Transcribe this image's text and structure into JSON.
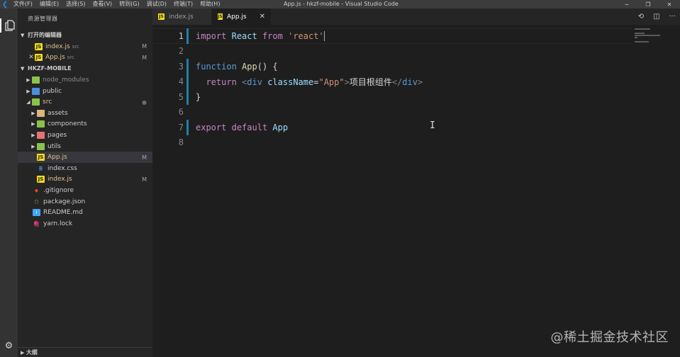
{
  "titlebar": {
    "menus": [
      "文件(F)",
      "编辑(E)",
      "选择(S)",
      "查看(V)",
      "转到(G)",
      "调试(D)",
      "终端(T)",
      "帮助(H)"
    ],
    "window_title": "App.js - hkzf-mobile - Visual Studio Code",
    "controls": {
      "minimize": "─",
      "restore": "❐",
      "close": "✕"
    }
  },
  "activitybar": {
    "explorer_icon": "files-icon",
    "settings_icon": "gear-icon"
  },
  "sidebar": {
    "title": "资源管理器",
    "open_editors": {
      "header": "打开的编辑器",
      "items": [
        {
          "name": "index.js",
          "desc": "src",
          "status": "M",
          "has_close": false
        },
        {
          "name": "App.js",
          "desc": "src",
          "status": "M",
          "has_close": true,
          "close": "✕"
        }
      ]
    },
    "project": {
      "header": "HKZF-MOBILE",
      "tree": [
        {
          "name": "node_modules",
          "status": ""
        },
        {
          "name": "public",
          "status": ""
        },
        {
          "name": "src",
          "status": "●"
        },
        {
          "name": "assets",
          "status": ""
        },
        {
          "name": "components",
          "status": ""
        },
        {
          "name": "pages",
          "status": ""
        },
        {
          "name": "utils",
          "status": ""
        },
        {
          "name": "App.js",
          "status": "M"
        },
        {
          "name": "index.css",
          "status": ""
        },
        {
          "name": "index.js",
          "status": "M"
        },
        {
          "name": ".gitignore",
          "status": ""
        },
        {
          "name": "package.json",
          "status": ""
        },
        {
          "name": "README.md",
          "status": ""
        },
        {
          "name": "yarn.lock",
          "status": ""
        }
      ]
    },
    "outline_header": "大纲"
  },
  "tabs": [
    {
      "label": "index.js",
      "active": false
    },
    {
      "label": "App.js",
      "active": true,
      "close": "✕"
    }
  ],
  "editor": {
    "line_numbers": [
      "1",
      "2",
      "3",
      "4",
      "5",
      "6",
      "7",
      "8"
    ],
    "lines": {
      "l1": {
        "import": "import",
        "React": "React",
        "from": "from",
        "str": "'react'"
      },
      "l3": {
        "function": "function",
        "name": "App",
        "rest": "() {"
      },
      "l4": {
        "return": "return",
        "open_lt": "<",
        "div": "div",
        "attr": "className",
        "eq": "=",
        "val": "\"App\"",
        "gt": ">",
        "text": "项目根组件",
        "close_lt": "</",
        "close_div": "div",
        "close_gt": ">"
      },
      "l5": {
        "brace": "}"
      },
      "l7": {
        "export": "export",
        "default": "default",
        "name": "App"
      }
    }
  },
  "watermark": "@稀土掘金技术社区",
  "colors": {
    "accent": "#1b81a8",
    "modified": "#e2c08d",
    "keyword": "#c586c0",
    "string": "#ce9178"
  }
}
